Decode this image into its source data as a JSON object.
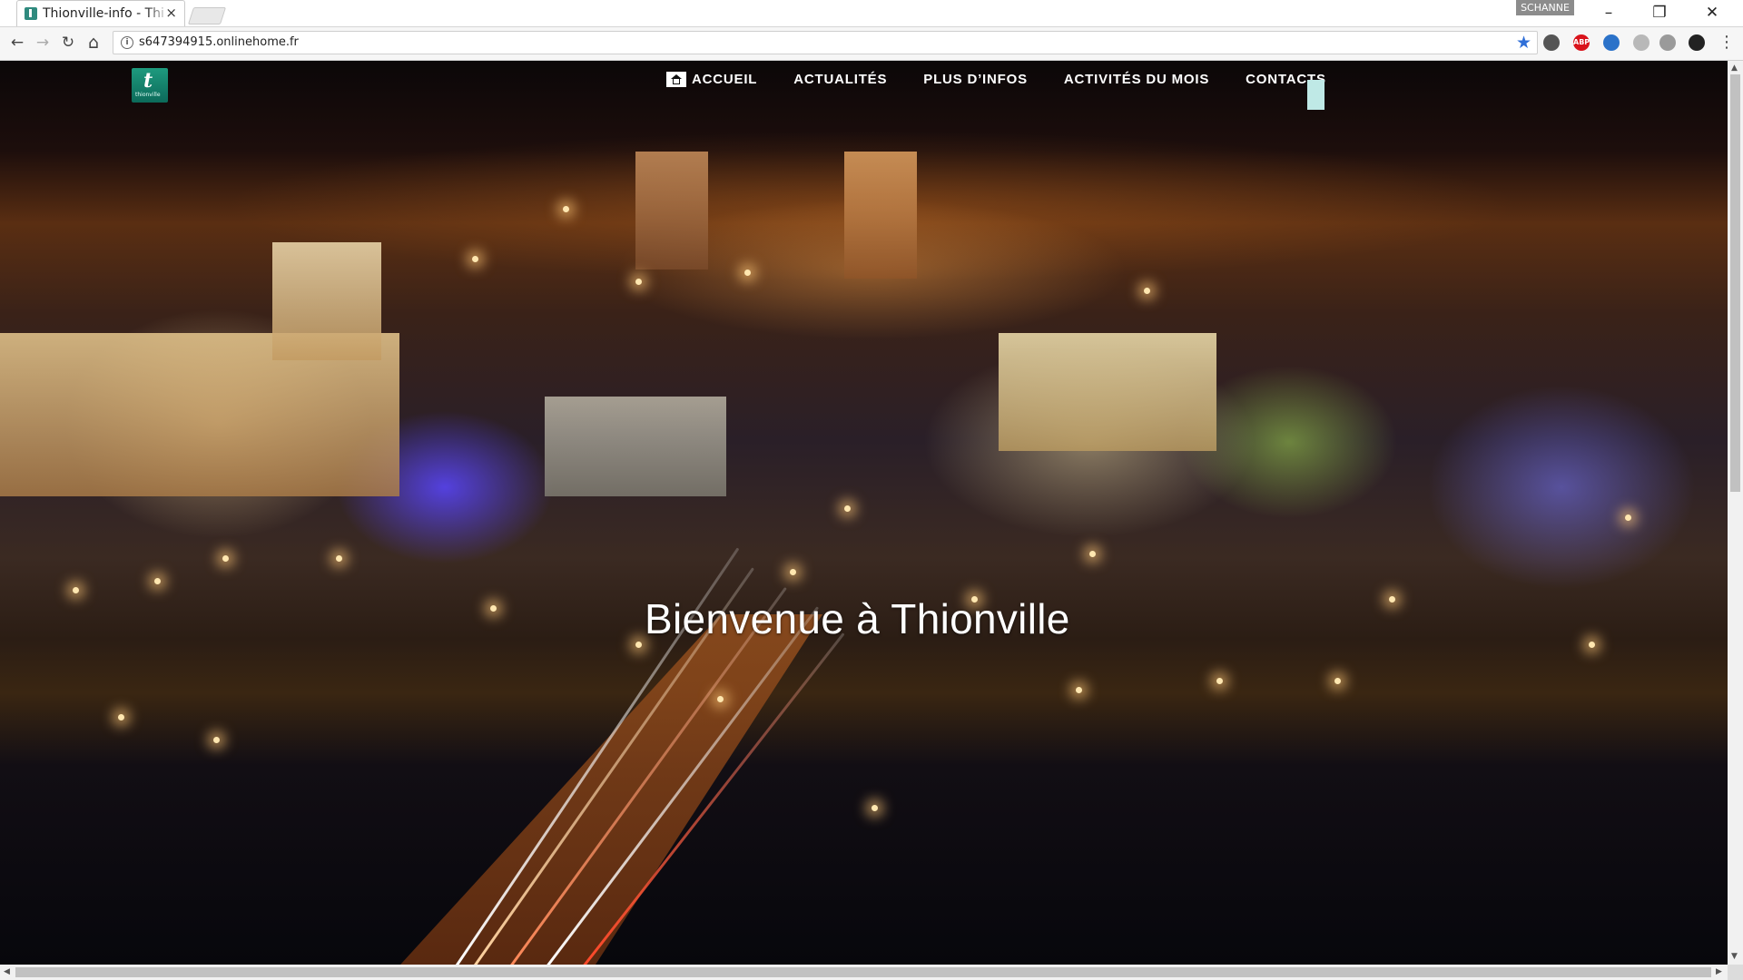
{
  "browser": {
    "tab_title": "Thionville-info - Thi",
    "tab_close": "×",
    "profile_name": "SCHANNE",
    "url": "s647394915.onlinehome.fr",
    "controls": {
      "minimize": "–",
      "restore": "❐",
      "close": "✕"
    },
    "nav": {
      "back": "←",
      "forward": "→",
      "reload": "↻",
      "home": "⌂"
    },
    "star": "★",
    "extensions": [
      {
        "name": "cast-icon",
        "label": "",
        "color": "#555555"
      },
      {
        "name": "adblock-plus-icon",
        "label": "ABP",
        "color": "#d9131b"
      },
      {
        "name": "extension-badge-icon",
        "label": "",
        "color": "#2b72c9"
      },
      {
        "name": "extension-gray-icon",
        "label": "",
        "color": "#b8b8b8"
      },
      {
        "name": "cloud-icon",
        "label": "",
        "color": "#9a9a9a"
      },
      {
        "name": "extension-dark-icon",
        "label": "",
        "color": "#222222"
      }
    ],
    "menu": "⋮"
  },
  "site": {
    "nav": [
      {
        "label": "ACCUEIL",
        "home": true
      },
      {
        "label": "ACTUALITÉS"
      },
      {
        "label": "PLUS D’INFOS"
      },
      {
        "label": "ACTIVITÉS DU MOIS"
      },
      {
        "label": "CONTACTS"
      }
    ],
    "headline": "Bienvenue à Thionville",
    "accent_color": "#bfe9e6",
    "logo_color": "#1e9a7e"
  }
}
